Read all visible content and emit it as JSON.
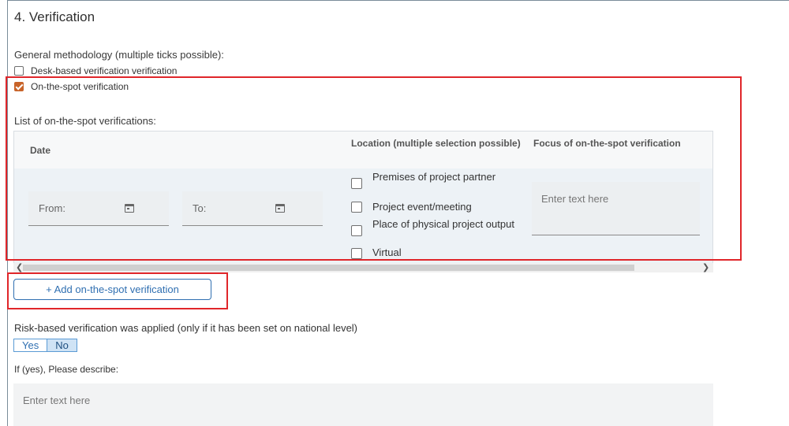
{
  "section": {
    "title": "4. Verification"
  },
  "methodology": {
    "heading": "General methodology (multiple ticks possible):",
    "options": [
      {
        "label": "Desk-based verification verification",
        "checked": false
      },
      {
        "label": "On-the-spot verification",
        "checked": true
      }
    ]
  },
  "onspot": {
    "heading": "List of on-the-spot verifications:",
    "columns": {
      "date": "Date",
      "location": "Location (multiple selection possible)",
      "focus": "Focus of on-the-spot verification"
    },
    "row": {
      "from_label": "From:",
      "to_label": "To:",
      "locations": [
        {
          "label": "Premises of project partner",
          "checked": false
        },
        {
          "label": "Project event/meeting",
          "checked": false
        },
        {
          "label": "Place of physical project output",
          "checked": false
        },
        {
          "label": "Virtual",
          "checked": false
        }
      ],
      "focus_placeholder": "Enter text here"
    },
    "add_button": "+ Add on-the-spot verification"
  },
  "risk": {
    "heading": "Risk-based verification was applied (only if it has been set on national level)",
    "yes": "Yes",
    "no": "No",
    "selected": "No",
    "describe_label": "If (yes), Please describe:",
    "describe_placeholder": "Enter text here"
  },
  "colors": {
    "accent": "#2f6fb1",
    "checked": "#c8642a",
    "highlight": "#e0262a"
  }
}
